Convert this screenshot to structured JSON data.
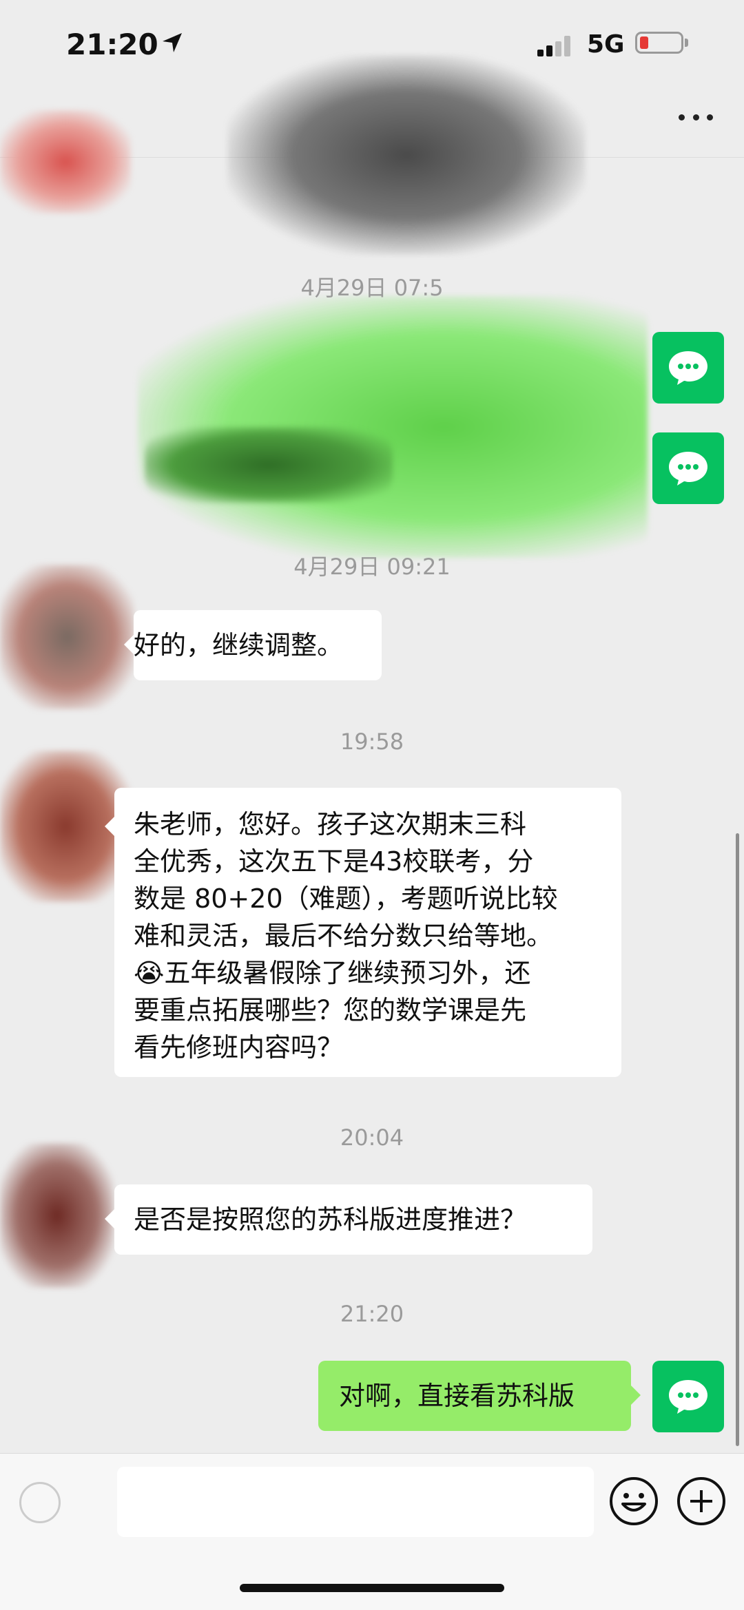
{
  "status_bar": {
    "time": "21:20",
    "network": "5G"
  },
  "header": {
    "more_icon": "more-icon"
  },
  "messages": [
    {
      "kind": "timestamp",
      "text": "4月29日 07:5"
    },
    {
      "kind": "timestamp",
      "text": "4月29日 09:21"
    },
    {
      "kind": "incoming",
      "text": "好的，继续调整。"
    },
    {
      "kind": "timestamp",
      "text": "19:58"
    },
    {
      "kind": "incoming",
      "lines": [
        "朱老师，您好。孩子这次期末三科",
        "全优秀，这次五下是43校联考，分",
        "数是 80+20（难题），考题听说比较",
        "难和灵活，最后不给分数只给等地。",
        "😭五年级暑假除了继续预习外，还",
        "要重点拓展哪些？您的数学课是先",
        "看先修班内容吗？"
      ]
    },
    {
      "kind": "timestamp",
      "text": "20:04"
    },
    {
      "kind": "incoming",
      "text": "是否是按照您的苏科版进度推进？"
    },
    {
      "kind": "timestamp",
      "text": "21:20"
    },
    {
      "kind": "outgoing",
      "text": "对啊，直接看苏科版"
    }
  ],
  "input_bar": {
    "placeholder": ""
  },
  "colors": {
    "outgoing_bubble": "#95ec69",
    "avatar_green": "#07c160",
    "background": "#ededed"
  }
}
